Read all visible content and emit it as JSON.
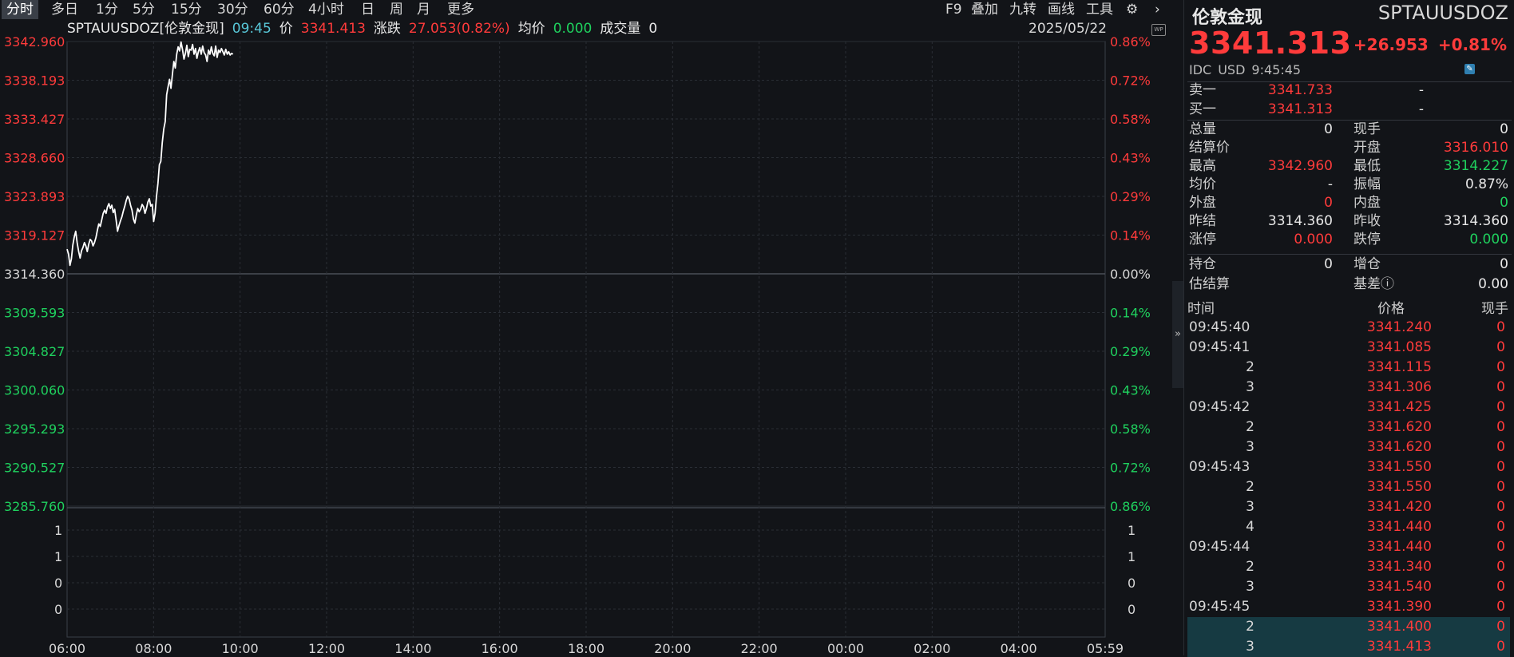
{
  "toolbar": {
    "periods": [
      "分时",
      "多日",
      "1分",
      "5分",
      "15分",
      "30分",
      "60分",
      "4小时",
      "日",
      "周",
      "月",
      "更多"
    ],
    "active": "分时",
    "right_items": [
      "F9",
      "叠加",
      "九转",
      "画线",
      "工具"
    ]
  },
  "infobar": {
    "symbol": "SPTAUUSDOZ[伦敦金现]",
    "time": "09:45",
    "price_label": "价",
    "price": "3341.413",
    "change_label": "涨跌",
    "change": "27.053(0.82%)",
    "avg_label": "均价",
    "avg": "0.000",
    "vol_label": "成交量",
    "vol": "0",
    "date": "2025/05/22"
  },
  "chart_data": {
    "type": "line",
    "y_labels_left": [
      "3342.960",
      "3338.193",
      "3333.427",
      "3328.660",
      "3323.893",
      "3319.127",
      "3314.360",
      "3309.593",
      "3304.827",
      "3300.060",
      "3295.293",
      "3290.527",
      "3285.760"
    ],
    "y_labels_right": [
      "0.86%",
      "0.72%",
      "0.58%",
      "0.43%",
      "0.29%",
      "0.14%",
      "0.00%",
      "0.14%",
      "0.29%",
      "0.43%",
      "0.58%",
      "0.72%",
      "0.86%"
    ],
    "ylim": [
      3285.76,
      3342.96
    ],
    "prev_close": 3314.36,
    "volume_labels": [
      "1",
      "1",
      "0",
      "0"
    ],
    "x_labels": [
      "06:00",
      "08:00",
      "10:00",
      "12:00",
      "14:00",
      "16:00",
      "18:00",
      "20:00",
      "22:00",
      "00:00",
      "02:00",
      "04:00",
      "05:59"
    ],
    "x_range_minutes": [
      0,
      1439
    ],
    "series": [
      {
        "points_minutes": [
          0,
          2,
          4,
          6,
          8,
          10,
          12,
          14,
          16,
          18,
          20,
          22,
          24,
          26,
          28,
          30,
          32,
          34,
          36,
          38,
          40,
          42,
          44,
          46,
          48,
          50,
          52,
          54,
          56,
          58,
          60,
          62,
          64,
          66,
          68,
          70,
          72,
          74,
          76,
          78,
          80,
          82,
          84,
          86,
          88,
          90,
          92,
          94,
          96,
          98,
          100,
          102,
          104,
          106,
          108,
          110,
          112,
          114,
          116,
          118,
          120,
          122,
          124,
          126,
          128,
          130,
          132,
          134,
          136,
          138,
          140,
          142,
          144,
          146,
          148,
          150,
          152,
          154,
          156,
          158,
          160,
          162,
          164,
          166,
          168,
          170,
          172,
          174,
          176,
          178,
          180,
          182,
          184,
          186,
          188,
          190,
          192,
          194,
          196,
          198,
          200,
          202,
          204,
          206,
          208,
          210,
          212,
          214,
          216,
          218,
          220,
          222,
          224,
          226,
          228,
          230
        ],
        "values": [
          3317.4,
          3316.8,
          3315.4,
          3316.2,
          3317.9,
          3318.9,
          3319.6,
          3318.2,
          3317.1,
          3316.3,
          3317.2,
          3317.6,
          3318.2,
          3317.8,
          3317.1,
          3318.0,
          3318.6,
          3318.4,
          3317.8,
          3318.2,
          3318.8,
          3319.7,
          3320.5,
          3320.2,
          3321.0,
          3321.8,
          3322.2,
          3321.8,
          3322.6,
          3323.0,
          3322.4,
          3322.8,
          3321.9,
          3322.3,
          3321.0,
          3319.6,
          3320.3,
          3320.9,
          3321.4,
          3322.1,
          3322.7,
          3323.4,
          3323.9,
          3323.6,
          3322.8,
          3322.2,
          3321.1,
          3320.6,
          3321.6,
          3322.4,
          3322.0,
          3322.3,
          3322.9,
          3322.6,
          3321.8,
          3322.4,
          3323.2,
          3323.6,
          3322.7,
          3322.9,
          3320.8,
          3321.8,
          3323.9,
          3325.5,
          3327.8,
          3328.2,
          3330.5,
          3332.2,
          3333.1,
          3336.4,
          3337.4,
          3338.3,
          3337.2,
          3338.9,
          3340.5,
          3339.7,
          3341.4,
          3342.3,
          3341.8,
          3342.9,
          3342.0,
          3340.8,
          3341.5,
          3342.5,
          3341.1,
          3342.0,
          3341.9,
          3342.6,
          3341.4,
          3342.1,
          3340.9,
          3341.7,
          3342.2,
          3341.4,
          3342.4,
          3341.6,
          3341.3,
          3340.5,
          3341.9,
          3341.4,
          3342.3,
          3341.5,
          3341.2,
          3342.4,
          3341.0,
          3341.9,
          3341.6,
          3342.1,
          3341.7,
          3341.3,
          3342.0,
          3341.4,
          3341.7,
          3341.3,
          3341.5,
          3341.4
        ]
      }
    ]
  },
  "panel": {
    "name": "伦敦金现",
    "code": "SPTAUUSDOZ",
    "price": "3341.313",
    "change": "+26.953",
    "change_pct": "+0.81%",
    "meta": [
      "IDC",
      "USD",
      "9:45:45"
    ],
    "sell1_label": "卖一",
    "sell1_price": "3341.733",
    "sell1_vol": "-",
    "buy1_label": "买一",
    "buy1_price": "3341.313",
    "buy1_vol": "-",
    "stats": [
      {
        "l1": "总量",
        "v1": "0",
        "c1": "white",
        "l2": "现手",
        "v2": "0",
        "c2": "white"
      },
      {
        "l1": "结算价",
        "v1": "",
        "c1": "white",
        "l2": "开盘",
        "v2": "3316.010",
        "c2": "red"
      },
      {
        "l1": "最高",
        "v1": "3342.960",
        "c1": "red",
        "l2": "最低",
        "v2": "3314.227",
        "c2": "green"
      },
      {
        "l1": "均价",
        "v1": "-",
        "c1": "white",
        "l2": "振幅",
        "v2": "0.87%",
        "c2": "white"
      },
      {
        "l1": "外盘",
        "v1": "0",
        "c1": "red",
        "l2": "内盘",
        "v2": "0",
        "c2": "green"
      },
      {
        "l1": "昨结",
        "v1": "3314.360",
        "c1": "white",
        "l2": "昨收",
        "v2": "3314.360",
        "c2": "white"
      },
      {
        "l1": "涨停",
        "v1": "0.000",
        "c1": "red",
        "l2": "跌停",
        "v2": "0.000",
        "c2": "green"
      }
    ],
    "stats2": [
      {
        "l1": "持仓",
        "v1": "0",
        "l2": "增仓",
        "v2": "0"
      },
      {
        "l1": "估结算",
        "v1": "",
        "l2": "基差ⓘ",
        "v2": "0.00"
      }
    ],
    "ticks_header": {
      "time": "时间",
      "price": "价格",
      "vol": "现手"
    },
    "ticks": [
      {
        "time": "09:45:40",
        "price": "3341.240",
        "vol": "0",
        "sub": false,
        "hl": false
      },
      {
        "time": "09:45:41",
        "price": "3341.085",
        "vol": "0",
        "sub": false,
        "hl": false
      },
      {
        "time": "2",
        "price": "3341.115",
        "vol": "0",
        "sub": true,
        "hl": false
      },
      {
        "time": "3",
        "price": "3341.306",
        "vol": "0",
        "sub": true,
        "hl": false
      },
      {
        "time": "09:45:42",
        "price": "3341.425",
        "vol": "0",
        "sub": false,
        "hl": false
      },
      {
        "time": "2",
        "price": "3341.620",
        "vol": "0",
        "sub": true,
        "hl": false
      },
      {
        "time": "3",
        "price": "3341.620",
        "vol": "0",
        "sub": true,
        "hl": false
      },
      {
        "time": "09:45:43",
        "price": "3341.550",
        "vol": "0",
        "sub": false,
        "hl": false
      },
      {
        "time": "2",
        "price": "3341.550",
        "vol": "0",
        "sub": true,
        "hl": false
      },
      {
        "time": "3",
        "price": "3341.420",
        "vol": "0",
        "sub": true,
        "hl": false
      },
      {
        "time": "4",
        "price": "3341.440",
        "vol": "0",
        "sub": true,
        "hl": false
      },
      {
        "time": "09:45:44",
        "price": "3341.440",
        "vol": "0",
        "sub": false,
        "hl": false
      },
      {
        "time": "2",
        "price": "3341.340",
        "vol": "0",
        "sub": true,
        "hl": false
      },
      {
        "time": "3",
        "price": "3341.540",
        "vol": "0",
        "sub": true,
        "hl": false
      },
      {
        "time": "09:45:45",
        "price": "3341.390",
        "vol": "0",
        "sub": false,
        "hl": false
      },
      {
        "time": "2",
        "price": "3341.400",
        "vol": "0",
        "sub": true,
        "hl": true
      },
      {
        "time": "3",
        "price": "3341.413",
        "vol": "0",
        "sub": true,
        "hl": true
      }
    ]
  },
  "colors": {
    "up": "#ff3b3b",
    "down": "#1fd15e",
    "line": "#ffffff",
    "grid": "#2a2e35",
    "axis": "#3a3f47"
  },
  "icons": {
    "settings": "gear-icon",
    "next": "chevron-right-icon",
    "collapse": "double-chevron-icon",
    "edit": "edit-icon",
    "wp": "wp-icon"
  }
}
